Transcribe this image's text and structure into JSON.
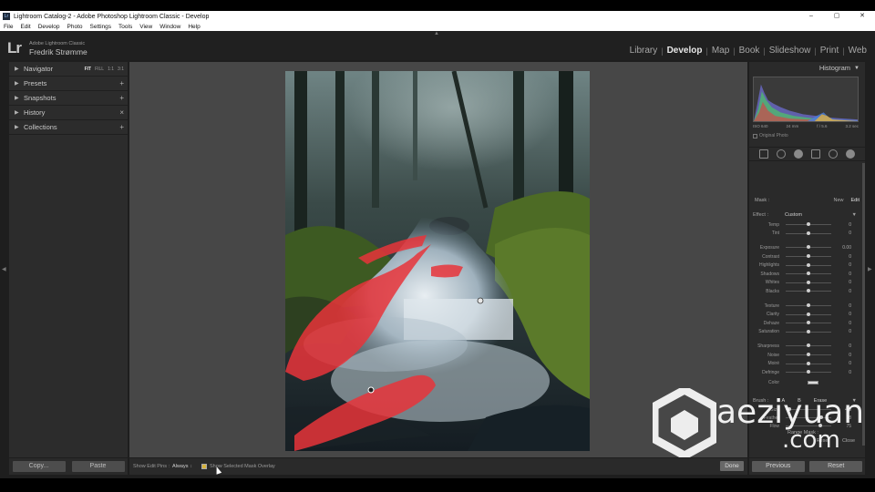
{
  "window": {
    "title": "Lightroom Catalog-2 - Adobe Photoshop Lightroom Classic - Develop",
    "minimize": "–",
    "maximize": "▢",
    "close": "✕"
  },
  "menu": [
    "File",
    "Edit",
    "Develop",
    "Photo",
    "Settings",
    "Tools",
    "View",
    "Window",
    "Help"
  ],
  "identity": {
    "logo": "Lr",
    "subtitle": "Adobe Lightroom Classic",
    "name": "Fredrik Strømme"
  },
  "modules": [
    "Library",
    "Develop",
    "Map",
    "Book",
    "Slideshow",
    "Print",
    "Web"
  ],
  "active_module": "Develop",
  "left_panel": {
    "navigator": {
      "label": "Navigator",
      "options": [
        "FIT",
        "FILL",
        "1:1",
        "3:1"
      ]
    },
    "items": [
      {
        "label": "Presets",
        "action": "+"
      },
      {
        "label": "Snapshots",
        "action": "+"
      },
      {
        "label": "History",
        "action": "×"
      },
      {
        "label": "Collections",
        "action": "+"
      }
    ]
  },
  "left_buttons": {
    "copy": "Copy...",
    "paste": "Paste"
  },
  "toolbar": {
    "show_edit_pins_label": "Show Edit Pins :",
    "show_edit_pins_value": "Always",
    "show_mask_overlay": "Show Selected Mask Overlay",
    "done": "Done"
  },
  "right_panel": {
    "histogram_label": "Histogram",
    "exif": [
      "ISO 640",
      "24 mm",
      "f / 5.6",
      "3.2 sec"
    ],
    "original_photo": "Original Photo",
    "mask_label": "Mask :",
    "mask_new": "New",
    "mask_edit": "Edit",
    "effect_label": "Effect :",
    "effect_value": "Custom",
    "sliders": [
      {
        "name": "Temp",
        "value": "0",
        "pos": 0.5
      },
      {
        "name": "Tint",
        "value": "0",
        "pos": 0.5
      },
      {
        "name": "Exposure",
        "value": "0.00",
        "pos": 0.5
      },
      {
        "name": "Contrast",
        "value": "0",
        "pos": 0.5
      },
      {
        "name": "Highlights",
        "value": "0",
        "pos": 0.5
      },
      {
        "name": "Shadows",
        "value": "0",
        "pos": 0.5
      },
      {
        "name": "Whites",
        "value": "0",
        "pos": 0.5
      },
      {
        "name": "Blacks",
        "value": "0",
        "pos": 0.5
      },
      {
        "name": "Texture",
        "value": "0",
        "pos": 0.5
      },
      {
        "name": "Clarity",
        "value": "0",
        "pos": 0.5
      },
      {
        "name": "Dehaze",
        "value": "0",
        "pos": 0.5
      },
      {
        "name": "Saturation",
        "value": "0",
        "pos": 0.5
      },
      {
        "name": "Sharpness",
        "value": "0",
        "pos": 0.5
      },
      {
        "name": "Noise",
        "value": "0",
        "pos": 0.5
      },
      {
        "name": "Moiré",
        "value": "0",
        "pos": 0.5
      },
      {
        "name": "Defringe",
        "value": "0",
        "pos": 0.5
      }
    ],
    "color_label": "Color",
    "brush_label": "Brush :",
    "brush_a": "A",
    "brush_b": "B",
    "brush_erase": "Erase",
    "brush_rows": [
      {
        "name": "Size",
        "value": "4.0",
        "pos": 0.08
      },
      {
        "name": "Feather",
        "value": "78",
        "pos": 0.78
      },
      {
        "name": "Flow",
        "value": "75",
        "pos": 0.75
      }
    ],
    "range_mask": "Range Mask :",
    "reset": "Reset",
    "close": "Close"
  },
  "right_buttons": {
    "previous": "Previous",
    "reset": "Reset"
  },
  "watermark": {
    "line1": "aeziyuan",
    "line2": ".com"
  }
}
